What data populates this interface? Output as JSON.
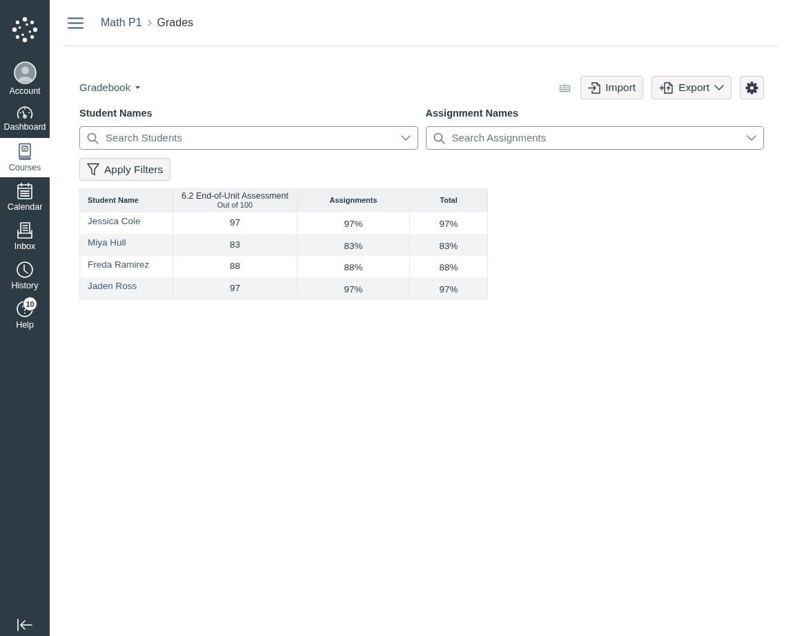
{
  "sidebar": {
    "items": [
      {
        "kind": "account",
        "label": "Account",
        "selected": false
      },
      {
        "kind": "dashboard",
        "label": "Dashboard",
        "selected": false
      },
      {
        "kind": "courses",
        "label": "Courses",
        "selected": true
      },
      {
        "kind": "calendar",
        "label": "Calendar",
        "selected": false
      },
      {
        "kind": "inbox",
        "label": "Inbox",
        "selected": false
      },
      {
        "kind": "history",
        "label": "History",
        "selected": false
      },
      {
        "kind": "help",
        "label": "Help",
        "selected": false,
        "badge": "10"
      }
    ]
  },
  "breadcrumb": [
    {
      "label": "Math P1"
    },
    {
      "label": "Grades"
    }
  ],
  "toolbar": {
    "view_menu": "Gradebook",
    "buttons": [
      {
        "kind": "import",
        "label": "Import"
      },
      {
        "kind": "export",
        "label": "Export"
      }
    ]
  },
  "filters": [
    {
      "label": "Student Names",
      "placeholder": "Search Students"
    },
    {
      "label": "Assignment Names",
      "placeholder": "Search Assignments"
    }
  ],
  "apply_button": "Apply Filters",
  "table": {
    "columns": [
      {
        "label": "Student Name"
      },
      {
        "label": "6.2 End-of-Unit Assessment",
        "sublabel": "Out of 100"
      },
      {
        "label": "Assignments"
      },
      {
        "label": "Total"
      }
    ],
    "rows": [
      [
        "Jessica Cole",
        "97",
        "97%",
        "97%"
      ],
      [
        "Miya Hull",
        "83",
        "83%",
        "83%"
      ],
      [
        "Freda Ramirez",
        "88",
        "88%",
        "88%"
      ],
      [
        "Jaden Ross",
        "97",
        "97%",
        "97%"
      ]
    ]
  }
}
